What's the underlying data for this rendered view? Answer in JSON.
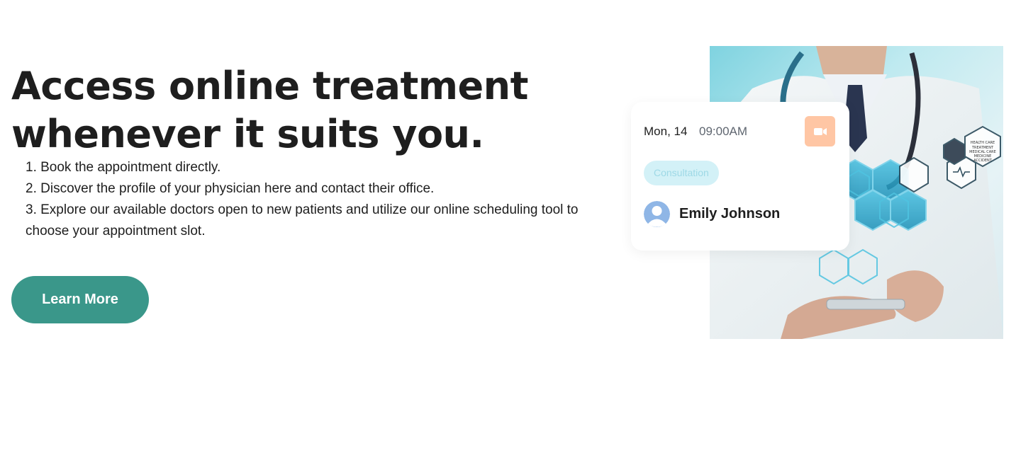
{
  "hero": {
    "headline": "Access online treatment whenever it suits you.",
    "steps": [
      "1. Book the appointment directly.",
      "2. Discover the profile of your physician here and contact their office.",
      "3. Explore our available doctors open to new patients and utilize our online scheduling tool to choose your appointment slot."
    ],
    "cta_label": "Learn More"
  },
  "appointment": {
    "date": "Mon, 14",
    "time": "09:00AM",
    "type_tag": "Consultation",
    "patient_name": "Emily Johnson",
    "action_icon": "video-camera-icon",
    "avatar_icon": "user-avatar-icon"
  },
  "image": {
    "label_lines": [
      "HEALTH CARE",
      "TREATMENT",
      "MEDICAL CARE",
      "MEDICINE",
      "ACCIDENT"
    ]
  },
  "colors": {
    "cta_background": "#3a978a",
    "video_button_background": "#ffc6a4",
    "tag_background": "#d3f1f7",
    "tag_text": "#9ed9e6",
    "avatar_color": "#8fb6e6"
  }
}
